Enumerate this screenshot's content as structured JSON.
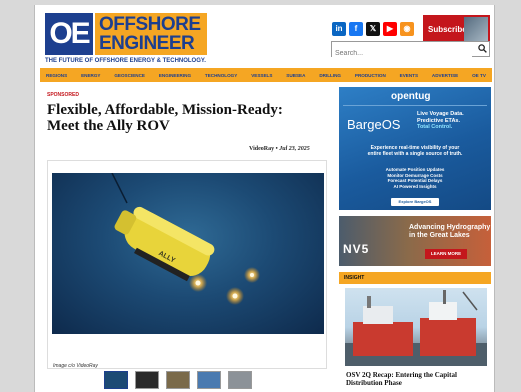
{
  "header": {
    "logo_mark": "OE",
    "logo_line1": "OFFSHORE",
    "logo_line2": "ENGINEER",
    "tagline": "THE FUTURE OF OFFSHORE ENERGY & TECHNOLOGY.",
    "social": [
      {
        "icon": "linkedin-icon",
        "glyph": "in",
        "color": "#0a66c2"
      },
      {
        "icon": "facebook-icon",
        "glyph": "f",
        "color": "#1877f2"
      },
      {
        "icon": "x-icon",
        "glyph": "𝕏",
        "color": "#111111"
      },
      {
        "icon": "youtube-icon",
        "glyph": "▶",
        "color": "#ff0000"
      },
      {
        "icon": "rss-icon",
        "glyph": "◉",
        "color": "#f7931e"
      }
    ],
    "subscribe_label": "Subscribe",
    "search_placeholder": "Search...",
    "search_value": ""
  },
  "nav": {
    "items": [
      "REGIONS",
      "ENERGY",
      "GEOSCIENCE",
      "ENGINEERING",
      "TECHNOLOGY",
      "VESSELS",
      "SUBSEA",
      "DRILLING",
      "PRODUCTION",
      "EVENTS",
      "ADVERTISE",
      "OE TV"
    ]
  },
  "article": {
    "badge": "SPONSORED",
    "title": "Flexible, Affordable, Mission-Ready: Meet the Ally ROV",
    "author": "VideoRay",
    "separator": " • ",
    "date": "Jul 23, 2025",
    "image_credit": "Image c/o VideoRay",
    "rov_label": "ALLY",
    "thumbnail_count": 5
  },
  "sidebar": {
    "ad1": {
      "brand": "opentug",
      "product": "BargeOS",
      "pitch_line1": "Live Voyage Data.",
      "pitch_line2": "Predictive ETAs.",
      "pitch_line3": "Total Control.",
      "sub_line1": "Experience real-time visibility of your",
      "sub_line2": "entire fleet with a single source of truth.",
      "features": [
        "Automate Position Updates",
        "Monitor Demurrage Costs",
        "Forecast Potential Delays",
        "AI Powered Insights"
      ],
      "cta": "Explore BargeOS"
    },
    "ad2": {
      "logo": "NV5",
      "head_line1": "Advancing Hydrography",
      "head_line2": "in the Great Lakes",
      "cta": "LEARN MORE"
    },
    "section_label": "INSIGHT",
    "news_title": "OSV 2Q Recap: Entering the Capital Distribution Phase"
  },
  "colors": {
    "brand_blue": "#1d3f8f",
    "brand_orange": "#f5a623",
    "accent_red": "#c4161c"
  }
}
